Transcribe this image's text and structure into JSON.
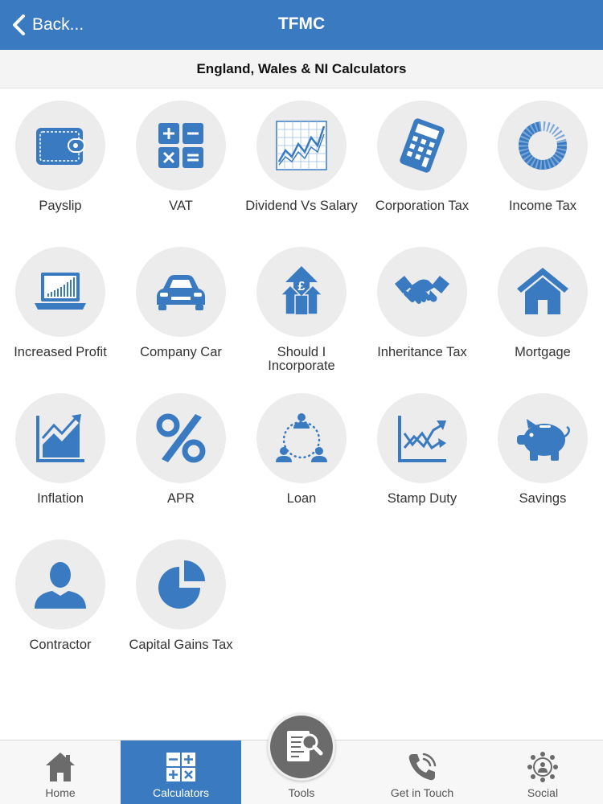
{
  "header": {
    "back_label": "Back...",
    "title": "TFMC"
  },
  "subheader": {
    "title": "England, Wales & NI Calculators"
  },
  "calculators": [
    {
      "label": "Payslip",
      "icon": "wallet-icon"
    },
    {
      "label": "VAT",
      "icon": "calculator-keys-icon"
    },
    {
      "label": "Dividend Vs Salary",
      "icon": "line-chart-icon"
    },
    {
      "label": "Corporation Tax",
      "icon": "calculator-icon"
    },
    {
      "label": "Income Tax",
      "icon": "donut-chart-icon"
    },
    {
      "label": "Increased Profit",
      "icon": "laptop-chart-icon"
    },
    {
      "label": "Company Car",
      "icon": "car-icon"
    },
    {
      "label": "Should I Incorporate",
      "icon": "pound-arrows-icon"
    },
    {
      "label": "Inheritance Tax",
      "icon": "handshake-icon"
    },
    {
      "label": "Mortgage",
      "icon": "house-icon"
    },
    {
      "label": "Inflation",
      "icon": "rising-area-chart-icon"
    },
    {
      "label": "APR",
      "icon": "percent-icon"
    },
    {
      "label": "Loan",
      "icon": "people-network-icon"
    },
    {
      "label": "Stamp Duty",
      "icon": "crossing-lines-chart-icon"
    },
    {
      "label": "Savings",
      "icon": "piggy-bank-icon"
    },
    {
      "label": "Contractor",
      "icon": "person-icon"
    },
    {
      "label": "Capital Gains Tax",
      "icon": "pie-chart-icon"
    }
  ],
  "tabs": [
    {
      "label": "Home",
      "icon": "home-icon",
      "active": false
    },
    {
      "label": "Calculators",
      "icon": "calculator-keys-icon",
      "active": true
    },
    {
      "label": "Tools",
      "icon": "document-search-icon",
      "active": false
    },
    {
      "label": "Get in Touch",
      "icon": "phone-icon",
      "active": false
    },
    {
      "label": "Social",
      "icon": "social-network-icon",
      "active": false
    }
  ],
  "colors": {
    "brand_blue": "#3a7ac1",
    "icon_blue": "#3a7ac1",
    "icon_circle": "#ececec",
    "tab_icon_grey": "#6b6b6b"
  }
}
